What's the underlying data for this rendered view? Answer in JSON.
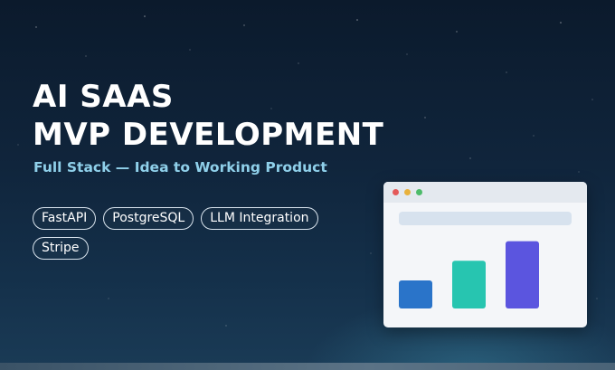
{
  "hero": {
    "title_line1": "AI SAAS",
    "title_line2": "MVP DEVELOPMENT",
    "subtitle": "Full Stack — Idea to Working Product"
  },
  "tags": [
    "FastAPI",
    "PostgreSQL",
    "LLM Integration",
    "Stripe"
  ],
  "mockup": {
    "window_dots": [
      "#e45a5a",
      "#e8b13c",
      "#4dbb6a"
    ],
    "bars": [
      {
        "value": 1,
        "color": "#2a74c9"
      },
      {
        "value": 1.7,
        "color": "#27c5b0"
      },
      {
        "value": 2.4,
        "color": "#5b55df"
      }
    ]
  },
  "colors": {
    "accent": "#8fd0ea",
    "background_top": "#0b1a2c",
    "background_bottom": "#1a3b56"
  }
}
